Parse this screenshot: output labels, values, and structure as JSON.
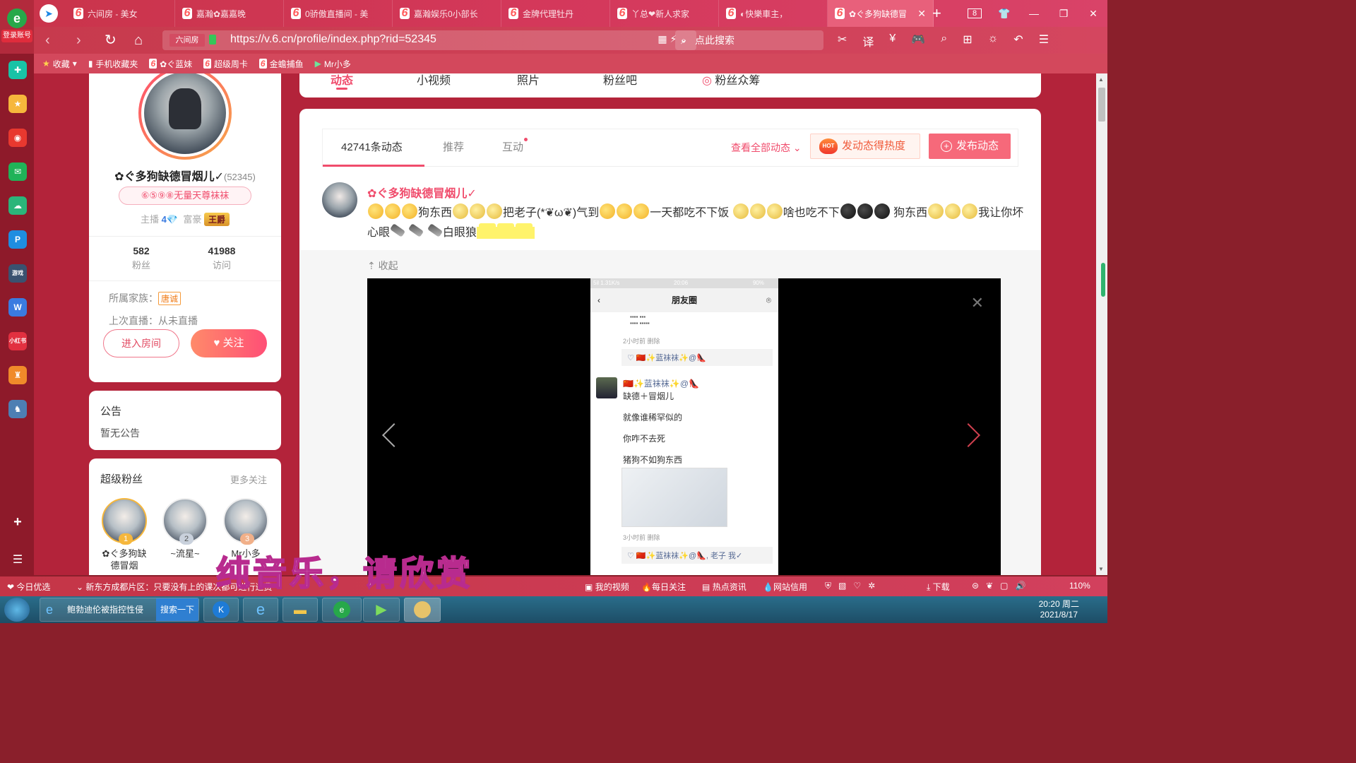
{
  "browser": {
    "login_label": "登录账号",
    "tabs": [
      {
        "label": "六间房 - 美女"
      },
      {
        "label": "嘉瀚✿嘉嘉晚"
      },
      {
        "label": "0骄傲直播间 - 美"
      },
      {
        "label": "嘉瀚娱乐0小部长"
      },
      {
        "label": "金牌代理牡丹"
      },
      {
        "label": "丫总❤新人求家"
      },
      {
        "label": "◐快樂車主，"
      },
      {
        "label": "✿ぐ多狗缺德冒"
      }
    ],
    "tab_count": "8",
    "url": "https://v.6.cn/profile/index.php?rid=52345",
    "site_label": "六间房",
    "search_placeholder": "点此搜索",
    "bookmarks": [
      "收藏",
      "手机收藏夹",
      "✿ぐ蓝妹",
      "超级周卡",
      "金蟾捕鱼",
      "Mr小多"
    ]
  },
  "profile": {
    "nickname": "✿ぐ多狗缺德冒烟儿✓",
    "rid": "(52345)",
    "honor": "⑥⑤⑨⑧无量天尊袜袜",
    "anchor_label": "主播",
    "anchor_level": "4",
    "rich_label": "富豪",
    "rich_level": "王爵",
    "fans_count": "582",
    "fans_label": "粉丝",
    "visits_count": "41988",
    "visits_label": "访问",
    "family_label": "所属家族：",
    "family_tag": "唐诚",
    "last_live": "上次直播：从未直播",
    "enter_room": "进入房间",
    "follow": "关注"
  },
  "notice": {
    "title": "公告",
    "value": "暂无公告"
  },
  "super_fans": {
    "title": "超级粉丝",
    "more": "更多关注",
    "fans": [
      {
        "rank": "1",
        "name": "✿ぐ多狗缺德冒烟"
      },
      {
        "rank": "2",
        "name": "~流星~"
      },
      {
        "rank": "3",
        "name": "Mr小多"
      }
    ]
  },
  "top_tabs": [
    "动态",
    "小视频",
    "照片",
    "粉丝吧",
    "粉丝众筹"
  ],
  "feed": {
    "tabs": [
      "42741条动态",
      "推荐",
      "互动"
    ],
    "view_all": "查看全部动态",
    "hot_button": "发动态得热度",
    "post_button": "发布动态",
    "post": {
      "author": "✿ぐ多狗缺德冒烟儿✓",
      "text_1": "狗东西",
      "text_2": "把老子(*❦ω❦)气到",
      "text_3": "一天都吃不下饭",
      "text_4": "啥也吃不下",
      "text_5": "狗东西",
      "text_6": "我让你坏心眼",
      "text_7": "白眼狼",
      "collapse": "收起"
    }
  },
  "phone_shot": {
    "status_left": "5il 1.31K/s",
    "status_time": "20:06",
    "status_batt": "90%",
    "title": "朋友圈",
    "meta_1": "2小时前  删除",
    "like_1": "♡ 🇨🇳✨蓝袜袜✨@👠",
    "user": "🇨🇳✨蓝袜袜✨@👠",
    "line_1": "缺德＋冒烟儿",
    "line_2": "就像谁稀罕似的",
    "line_3": "你咋不去死",
    "line_4": "猪狗不如狗东西",
    "meta_2": "3小时前  删除",
    "like_2": "♡ 🇨🇳✨蓝袜袜✨@👠, 老子 我✓"
  },
  "subtitle": "纯音乐，请欣赏",
  "statusbar": {
    "today": "今日优选",
    "news": "新东方成都片区：只要没有上的课次都可进行退费",
    "items": [
      "我的视频",
      "每日关注",
      "热点资讯",
      "网站信用",
      "下载",
      "110%"
    ]
  },
  "taskbar": {
    "app1": "鲍勃迪伦被指控性侵",
    "app1_btn": "搜索一下",
    "time": "20:20 周二",
    "date": "2021/8/17"
  }
}
